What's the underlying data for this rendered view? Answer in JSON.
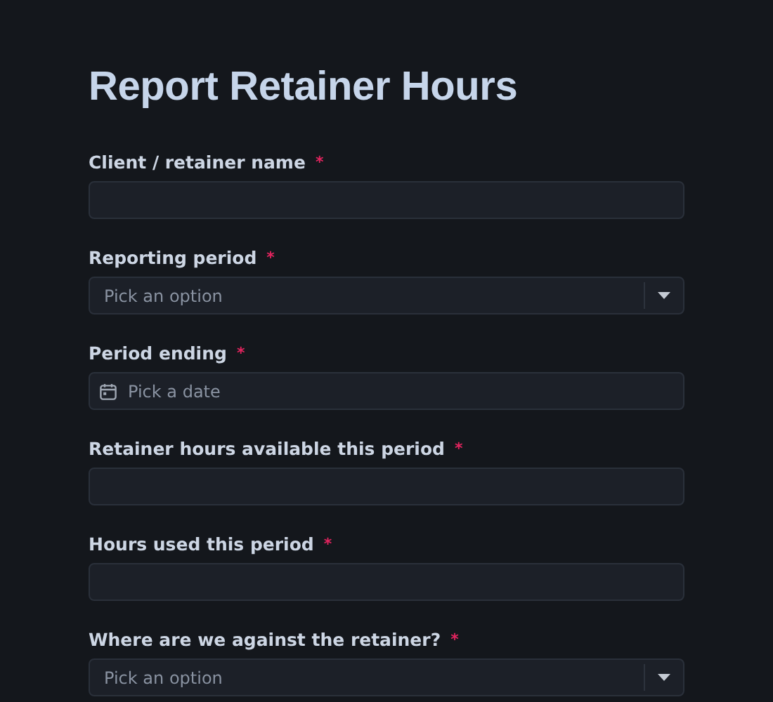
{
  "title": "Report Retainer Hours",
  "required_mark": "*",
  "fields": [
    {
      "label": "Client / retainer name",
      "required": true,
      "kind": "text"
    },
    {
      "label": "Reporting period",
      "required": true,
      "kind": "select",
      "placeholder": "Pick an option"
    },
    {
      "label": "Period ending",
      "required": true,
      "kind": "date",
      "placeholder": "Pick a date"
    },
    {
      "label": "Retainer hours available this period",
      "required": true,
      "kind": "text"
    },
    {
      "label": "Hours used this period",
      "required": true,
      "kind": "text"
    },
    {
      "label": "Where are we against the retainer?",
      "required": true,
      "kind": "select",
      "placeholder": "Pick an option"
    }
  ]
}
